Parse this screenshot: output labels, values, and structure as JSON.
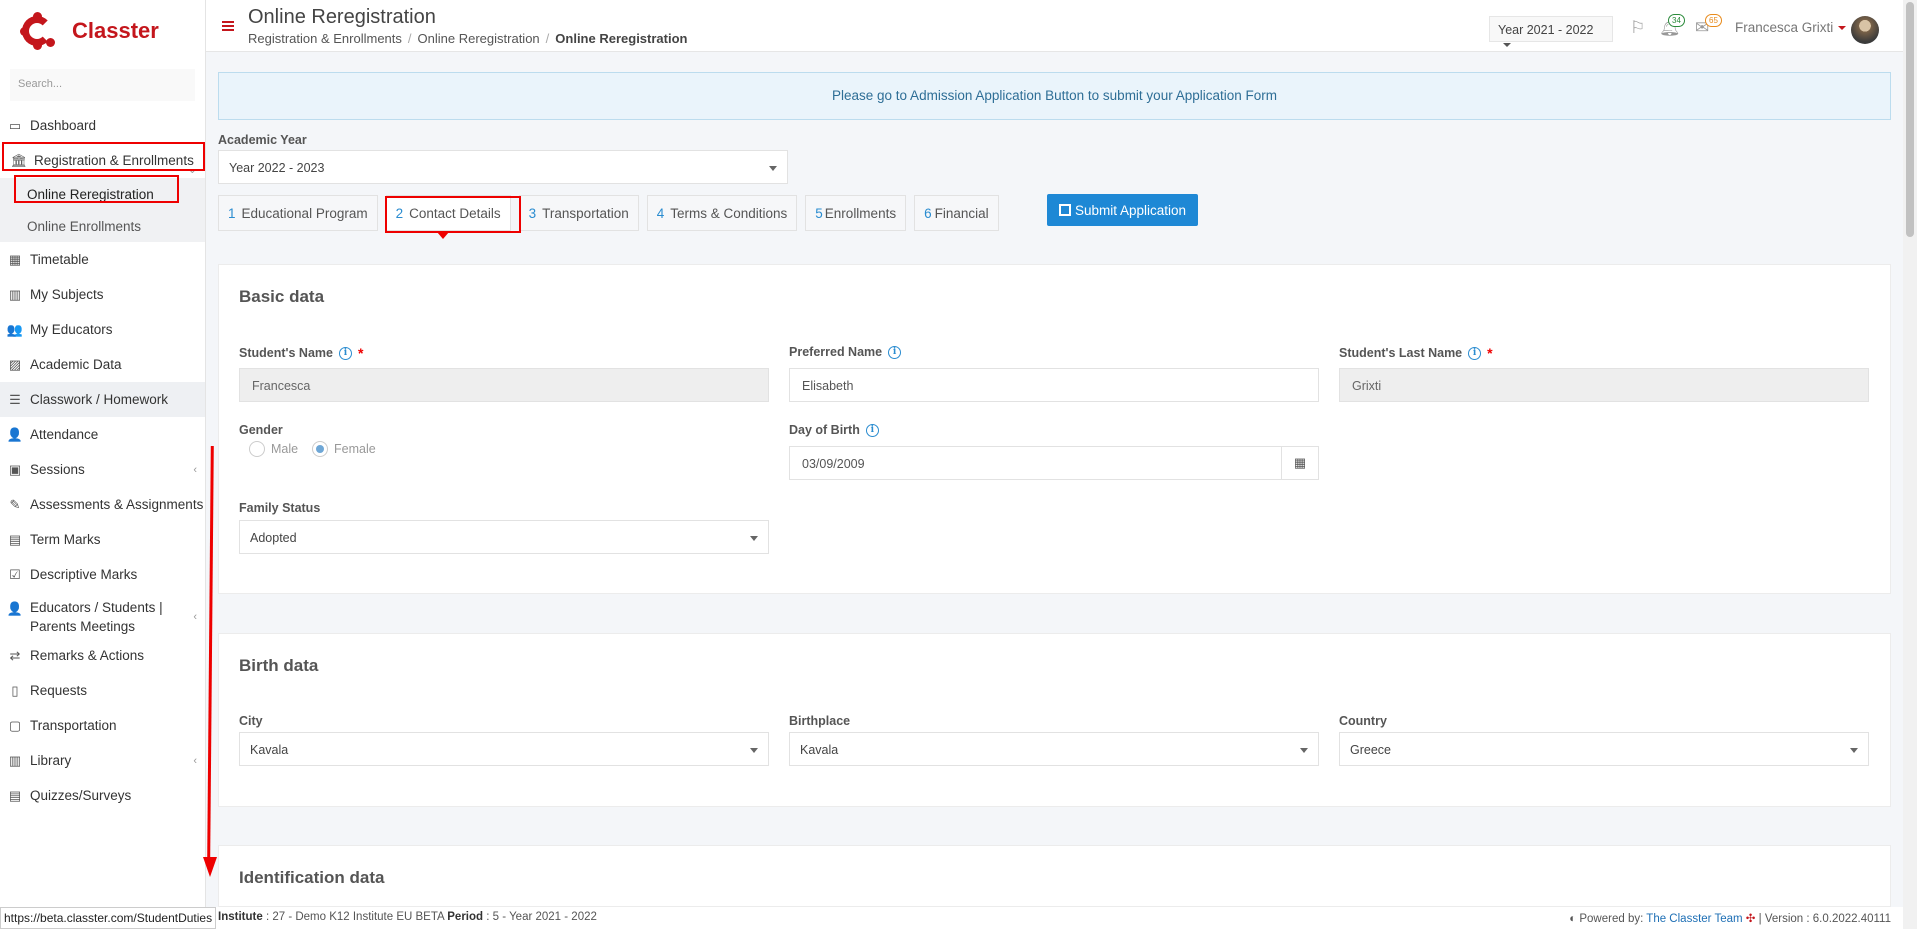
{
  "app": {
    "logo_text": "Classter",
    "search_placeholder": "Search..."
  },
  "sidebar": {
    "items": [
      {
        "label": "Dashboard",
        "icon": "laptop-icon"
      },
      {
        "label": "Registration & Enrollments",
        "icon": "bank-icon"
      },
      {
        "label": "Timetable",
        "icon": "calendar-icon"
      },
      {
        "label": "My Subjects",
        "icon": "book-icon"
      },
      {
        "label": "My Educators",
        "icon": "users-icon"
      },
      {
        "label": "Academic Data",
        "icon": "chart-icon"
      },
      {
        "label": "Classwork / Homework",
        "icon": "list-icon"
      },
      {
        "label": "Attendance",
        "icon": "user-check-icon"
      },
      {
        "label": "Sessions",
        "icon": "presentation-icon"
      },
      {
        "label": "Assessments & Assignments",
        "icon": "edit-icon"
      },
      {
        "label": "Term Marks",
        "icon": "folder-icon"
      },
      {
        "label": "Descriptive Marks",
        "icon": "check-doc-icon"
      },
      {
        "label": "Educators / Students | Parents Meetings",
        "icon": "meeting-icon"
      },
      {
        "label": "Remarks & Actions",
        "icon": "shuffle-icon"
      },
      {
        "label": "Requests",
        "icon": "file-icon"
      },
      {
        "label": "Transportation",
        "icon": "bus-icon"
      },
      {
        "label": "Library",
        "icon": "library-icon"
      },
      {
        "label": "Quizzes/Surveys",
        "icon": "quiz-icon"
      }
    ],
    "sub_items": [
      {
        "label": "Online Reregistration"
      },
      {
        "label": "Online Enrollments"
      }
    ]
  },
  "header": {
    "title": "Online Reregistration",
    "breadcrumb": [
      "Registration & Enrollments",
      "Online Reregistration",
      "Online Reregistration"
    ],
    "year_select": "Year 2021 - 2022",
    "notifications_count": "34",
    "messages_count": "65",
    "user_name": "Francesca Grixti"
  },
  "notice": "Please go to Admission Application Button to submit your Application Form",
  "academic_year": {
    "label": "Academic Year",
    "value": "Year 2022 - 2023"
  },
  "tabs": [
    {
      "num": "1",
      "label": "Educational Program"
    },
    {
      "num": "2",
      "label": "Contact Details"
    },
    {
      "num": "3",
      "label": "Transportation"
    },
    {
      "num": "4",
      "label": "Terms & Conditions"
    },
    {
      "num": "5",
      "label": "Enrollments"
    },
    {
      "num": "6",
      "label": "Financial"
    }
  ],
  "submit_label": "Submit Application",
  "basic": {
    "title": "Basic data",
    "student_name_label": "Student's Name",
    "student_name": "Francesca",
    "preferred_name_label": "Preferred Name",
    "preferred_name": "Elisabeth",
    "last_name_label": "Student's Last Name",
    "last_name": "Grixti",
    "gender_label": "Gender",
    "gender_male": "Male",
    "gender_female": "Female",
    "dob_label": "Day of Birth",
    "dob": "03/09/2009",
    "family_status_label": "Family Status",
    "family_status": "Adopted"
  },
  "birth": {
    "title": "Birth data",
    "city_label": "City",
    "city": "Kavala",
    "birthplace_label": "Birthplace",
    "birthplace": "Kavala",
    "country_label": "Country",
    "country": "Greece"
  },
  "identification": {
    "title": "Identification data"
  },
  "footer": {
    "status_url": "https://beta.classter.com/StudentDuties",
    "institute_label": "Institute",
    "institute": ": 27 - Demo K12 Institute EU BETA",
    "period_label": "Period",
    "period": ": 5 - Year 2021 - 2022",
    "powered_by": "Powered by:",
    "team": "The Classter Team",
    "version": "| Version : 6.0.2022.40111"
  },
  "colors": {
    "brand": "#c4161c",
    "accent": "#1e88d5",
    "highlight": "#ee0000"
  }
}
